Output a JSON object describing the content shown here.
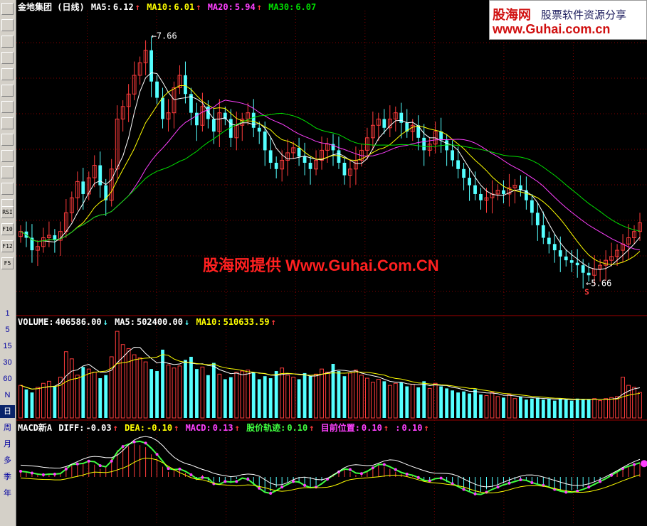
{
  "price_header": {
    "name": "金地集团 (日线)",
    "ma5_label": "MA5:",
    "ma5_value": "6.12",
    "ma10_label": "MA10:",
    "ma10_value": "6.01",
    "ma20_label": "MA20:",
    "ma20_value": "5.94",
    "ma30_label": "MA30:",
    "ma30_value": "6.07",
    "up_arrow": "↑"
  },
  "volume_header": {
    "vol_label": "VOLUME:",
    "vol_value": "406586.00",
    "ma5_label": "MA5:",
    "ma5_value": "502400.00",
    "ma10_label": "MA10:",
    "ma10_value": "510633.59",
    "down_arrow": "↓",
    "up_arrow": "↑"
  },
  "macd_header": {
    "name": "MACD新A",
    "diff_label": "DIFF:",
    "diff_value": "-0.03",
    "dea_label": "DEA:",
    "dea_value": "-0.10",
    "macd_label": "MACD:",
    "macd_value": "0.13",
    "track_label": "股价轨迹:",
    "track_value": "0.10",
    "pos_label": "目前位置:",
    "pos_value": "0.10",
    "extra_label": ":",
    "extra_value": "0.10",
    "up_arrow": "↑"
  },
  "annotations": {
    "high_label": "7.66",
    "low_label": "5.66",
    "low_marker": "S"
  },
  "watermark": "股海网提供 Www.Guhai.Com.CN",
  "logo": {
    "line1": "股海网",
    "line2": "股票软件资源分享",
    "line3": "www.Guhai.com.cn"
  },
  "toolbar": {
    "periods": [
      "1",
      "5",
      "15",
      "30",
      "60",
      "N",
      "日",
      "周",
      "月",
      "多",
      "季",
      "年"
    ],
    "active_period": "日",
    "buttons": [
      "RSI",
      "F10",
      "F12",
      "F5"
    ]
  },
  "colors": {
    "up": "#ff3c3c",
    "down": "#54ffff",
    "ma5": "#ffffff",
    "ma10": "#ffff00",
    "ma20": "#ff40ff",
    "ma30": "#00e000",
    "grid": "#800000",
    "track": "#40ff40"
  },
  "chart_data": [
    {
      "type": "candlestick",
      "title": "金地集团 (日线)",
      "ylim": [
        5.4,
        7.8
      ],
      "high": 7.66,
      "low": 5.66,
      "close": [
        6.05,
        6.0,
        5.9,
        5.93,
        6.0,
        6.02,
        5.98,
        6.05,
        6.2,
        6.32,
        6.45,
        6.35,
        6.48,
        6.58,
        6.42,
        6.3,
        6.55,
        6.95,
        7.05,
        7.15,
        7.3,
        7.4,
        7.5,
        7.25,
        7.12,
        6.95,
        7.0,
        7.2,
        7.3,
        7.15,
        7.0,
        6.9,
        7.05,
        6.95,
        6.85,
        7.0,
        6.95,
        6.8,
        6.9,
        6.95,
        7.0,
        6.88,
        6.85,
        6.7,
        6.6,
        6.55,
        6.62,
        6.68,
        6.72,
        6.65,
        6.6,
        6.55,
        6.62,
        6.7,
        6.75,
        6.7,
        6.6,
        6.5,
        6.55,
        6.62,
        6.7,
        6.8,
        6.9,
        6.95,
        6.88,
        6.95,
        7.0,
        6.92,
        6.85,
        6.9,
        6.8,
        6.7,
        6.75,
        6.85,
        6.78,
        6.7,
        6.62,
        6.55,
        6.48,
        6.42,
        6.35,
        6.3,
        6.32,
        6.35,
        6.38,
        6.35,
        6.4,
        6.42,
        6.38,
        6.3,
        6.2,
        6.1,
        6.0,
        5.95,
        5.9,
        5.85,
        5.82,
        5.8,
        5.78,
        5.72,
        5.7,
        5.75,
        5.78,
        5.82,
        5.85,
        5.9,
        5.95,
        6.0,
        6.05,
        6.12
      ]
    },
    {
      "type": "bar",
      "title": "VOLUME",
      "values": [
        3.2,
        2.8,
        2.5,
        3.0,
        3.4,
        3.6,
        3.1,
        4.0,
        6.5,
        5.8,
        4.2,
        5.0,
        4.8,
        4.5,
        3.9,
        4.2,
        6.0,
        8.5,
        7.2,
        6.8,
        6.2,
        5.9,
        5.5,
        4.8,
        4.6,
        6.7,
        5.2,
        4.9,
        5.1,
        5.7,
        6.0,
        4.8,
        5.0,
        4.2,
        5.4,
        4.3,
        3.8,
        4.0,
        4.5,
        4.6,
        4.7,
        4.5,
        3.8,
        4.1,
        3.9,
        4.6,
        4.9,
        4.2,
        4.0,
        3.8,
        4.4,
        4.1,
        4.3,
        4.8,
        4.5,
        5.3,
        4.6,
        4.1,
        4.4,
        4.7,
        4.2,
        3.9,
        3.5,
        3.8,
        3.6,
        3.2,
        3.4,
        3.5,
        3.1,
        3.3,
        3.0,
        3.6,
        2.9,
        3.4,
        3.1,
        2.9,
        2.7,
        2.5,
        2.6,
        2.4,
        2.8,
        2.3,
        2.2,
        2.5,
        2.1,
        2.0,
        2.3,
        1.9,
        2.1,
        1.8,
        1.9,
        2.0,
        1.8,
        1.9,
        1.7,
        1.9,
        1.8,
        1.7,
        1.9,
        1.8,
        1.8,
        1.9,
        1.7,
        1.9,
        2.0,
        2.1,
        4.0,
        3.2,
        3.0,
        2.5
      ]
    },
    {
      "type": "bar",
      "title": "MACD",
      "ylim": [
        -0.45,
        0.45
      ],
      "values": [
        0.05,
        0.04,
        0.03,
        0.02,
        0.02,
        0.03,
        0.02,
        0.04,
        0.1,
        0.12,
        0.11,
        0.13,
        0.15,
        0.12,
        0.08,
        0.1,
        0.18,
        0.26,
        0.28,
        0.3,
        0.32,
        0.31,
        0.29,
        0.22,
        0.18,
        0.1,
        0.05,
        0.08,
        0.06,
        0.04,
        0.0,
        -0.03,
        0.02,
        -0.04,
        -0.08,
        -0.05,
        -0.03,
        -0.06,
        -0.02,
        0.0,
        -0.04,
        -0.08,
        -0.12,
        -0.15,
        -0.14,
        -0.1,
        -0.08,
        -0.05,
        -0.03,
        -0.06,
        -0.09,
        -0.1,
        -0.08,
        -0.04,
        0.0,
        0.03,
        0.06,
        0.08,
        0.05,
        0.02,
        0.04,
        0.06,
        0.1,
        0.12,
        0.1,
        0.08,
        0.05,
        0.03,
        0.02,
        0.01,
        -0.02,
        -0.04,
        -0.03,
        0.0,
        -0.02,
        -0.05,
        -0.07,
        -0.1,
        -0.12,
        -0.14,
        -0.16,
        -0.15,
        -0.12,
        -0.1,
        -0.08,
        -0.06,
        -0.05,
        -0.03,
        -0.02,
        -0.04,
        -0.06,
        -0.07,
        -0.08,
        -0.1,
        -0.12,
        -0.13,
        -0.14,
        -0.13,
        -0.12,
        -0.1,
        -0.08,
        -0.05,
        -0.03,
        0.0,
        0.03,
        0.06,
        0.09,
        0.1,
        0.12,
        0.13
      ]
    }
  ]
}
